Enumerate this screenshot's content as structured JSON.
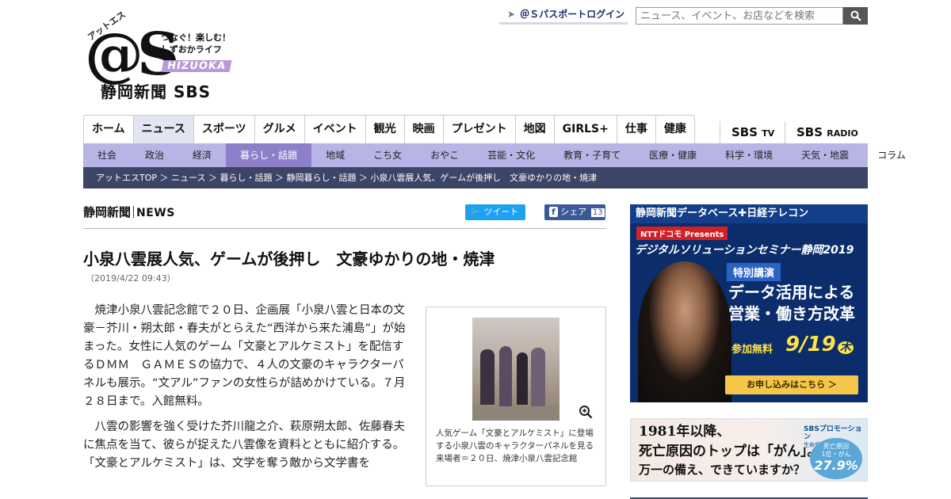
{
  "logo": {
    "kana": "アットエス",
    "mark": "@S",
    "tagline1": "つなぐ！楽しむ！",
    "tagline2": "しずおかライフ",
    "shizuoka": "HIZUOKA",
    "company": "静岡新聞 SBS"
  },
  "header": {
    "login_label": "＠Ｓパスポートログイン",
    "search_placeholder": "ニュース、イベント、お店などを検索"
  },
  "main_nav": [
    {
      "label": "ホーム"
    },
    {
      "label": "ニュース",
      "active": true
    },
    {
      "label": "スポーツ"
    },
    {
      "label": "グルメ"
    },
    {
      "label": "イベント"
    },
    {
      "label": "観光"
    },
    {
      "label": "映画"
    },
    {
      "label": "プレゼント"
    },
    {
      "label": "地図"
    },
    {
      "label": "GIRLS+"
    },
    {
      "label": "仕事"
    },
    {
      "label": "健康"
    }
  ],
  "media": {
    "tv": "SBS",
    "tv_suffix": "TV",
    "radio": "SBS",
    "radio_suffix": "RADIO"
  },
  "sub_nav": [
    {
      "label": "社会"
    },
    {
      "label": "政治"
    },
    {
      "label": "経済"
    },
    {
      "label": "暮らし・話題",
      "active": true
    },
    {
      "label": "地域"
    },
    {
      "label": "こち女"
    },
    {
      "label": "おやこ"
    },
    {
      "label": "芸能・文化"
    },
    {
      "label": "教育・子育て"
    },
    {
      "label": "医療・健康"
    },
    {
      "label": "科学・環境"
    },
    {
      "label": "天気・地震"
    },
    {
      "label": "コラム"
    }
  ],
  "breadcrumb": "アットエスTOP ＞ ニュース ＞ 暮らし・話題 ＞ 静岡暮らし・話題 ＞ 小泉八雲展人気、ゲームが後押し　文豪ゆかりの地・焼津",
  "article": {
    "source_ja": "静岡新聞",
    "source_en": "NEWS",
    "tweet_label": "ツイート",
    "share_label": "シェア",
    "share_count": "13",
    "title": "小泉八雲展人気、ゲームが後押し　文豪ゆかりの地・焼津",
    "date": "（2019/4/22 09:43）",
    "paragraphs": [
      "焼津小泉八雲記念館で２０日、企画展「小泉八雲と日本の文豪－芥川・朔太郎・春夫がとらえた“西洋から来た浦島”」が始まった。女性に人気のゲーム「文豪とアルケミスト」を配信するＤＭＭ　ＧＡＭＥＳの協力で、４人の文豪のキャラクターパネルも展示。“文アル”ファンの女性らが詰めかけている。７月２８日まで。入館無料。",
      "八雲の影響を強く受けた芥川龍之介、萩原朔太郎、佐藤春夫に焦点を当て、彼らが捉えた八雲像を資料とともに紹介する。「文豪とアルケミスト」は、文学を奪う敵から文学書を"
    ],
    "caption": "人気ゲーム「文豪とアルケミスト」に登場する小泉八雲のキャラクターパネルを見る来場者＝２０日、焼津小泉八雲記念館"
  },
  "ads": {
    "ad1": {
      "top": "静岡新聞データベース✚日経テレコン",
      "sponsor": "NTTドコモ Presents",
      "seminar": "デジタルソリューションセミナー静岡2019",
      "special": "特別講演",
      "headline1": "データ活用による",
      "headline2": "営業・働き方改革",
      "free": "参加無料",
      "date": "9/19",
      "weekday": "木",
      "cta": "お申し込みはこちら ＞"
    },
    "ad2": {
      "line1": "1981年以降、",
      "line2": "死亡原因のトップは「がん」。",
      "line3": "万一の備え、できていますか？",
      "brand": "SBSプロモーション",
      "brand_sub": "生命保険部",
      "stat_label": "死亡原因",
      "stat_rank": "1位・がん",
      "stat_value": "27.9%"
    }
  }
}
